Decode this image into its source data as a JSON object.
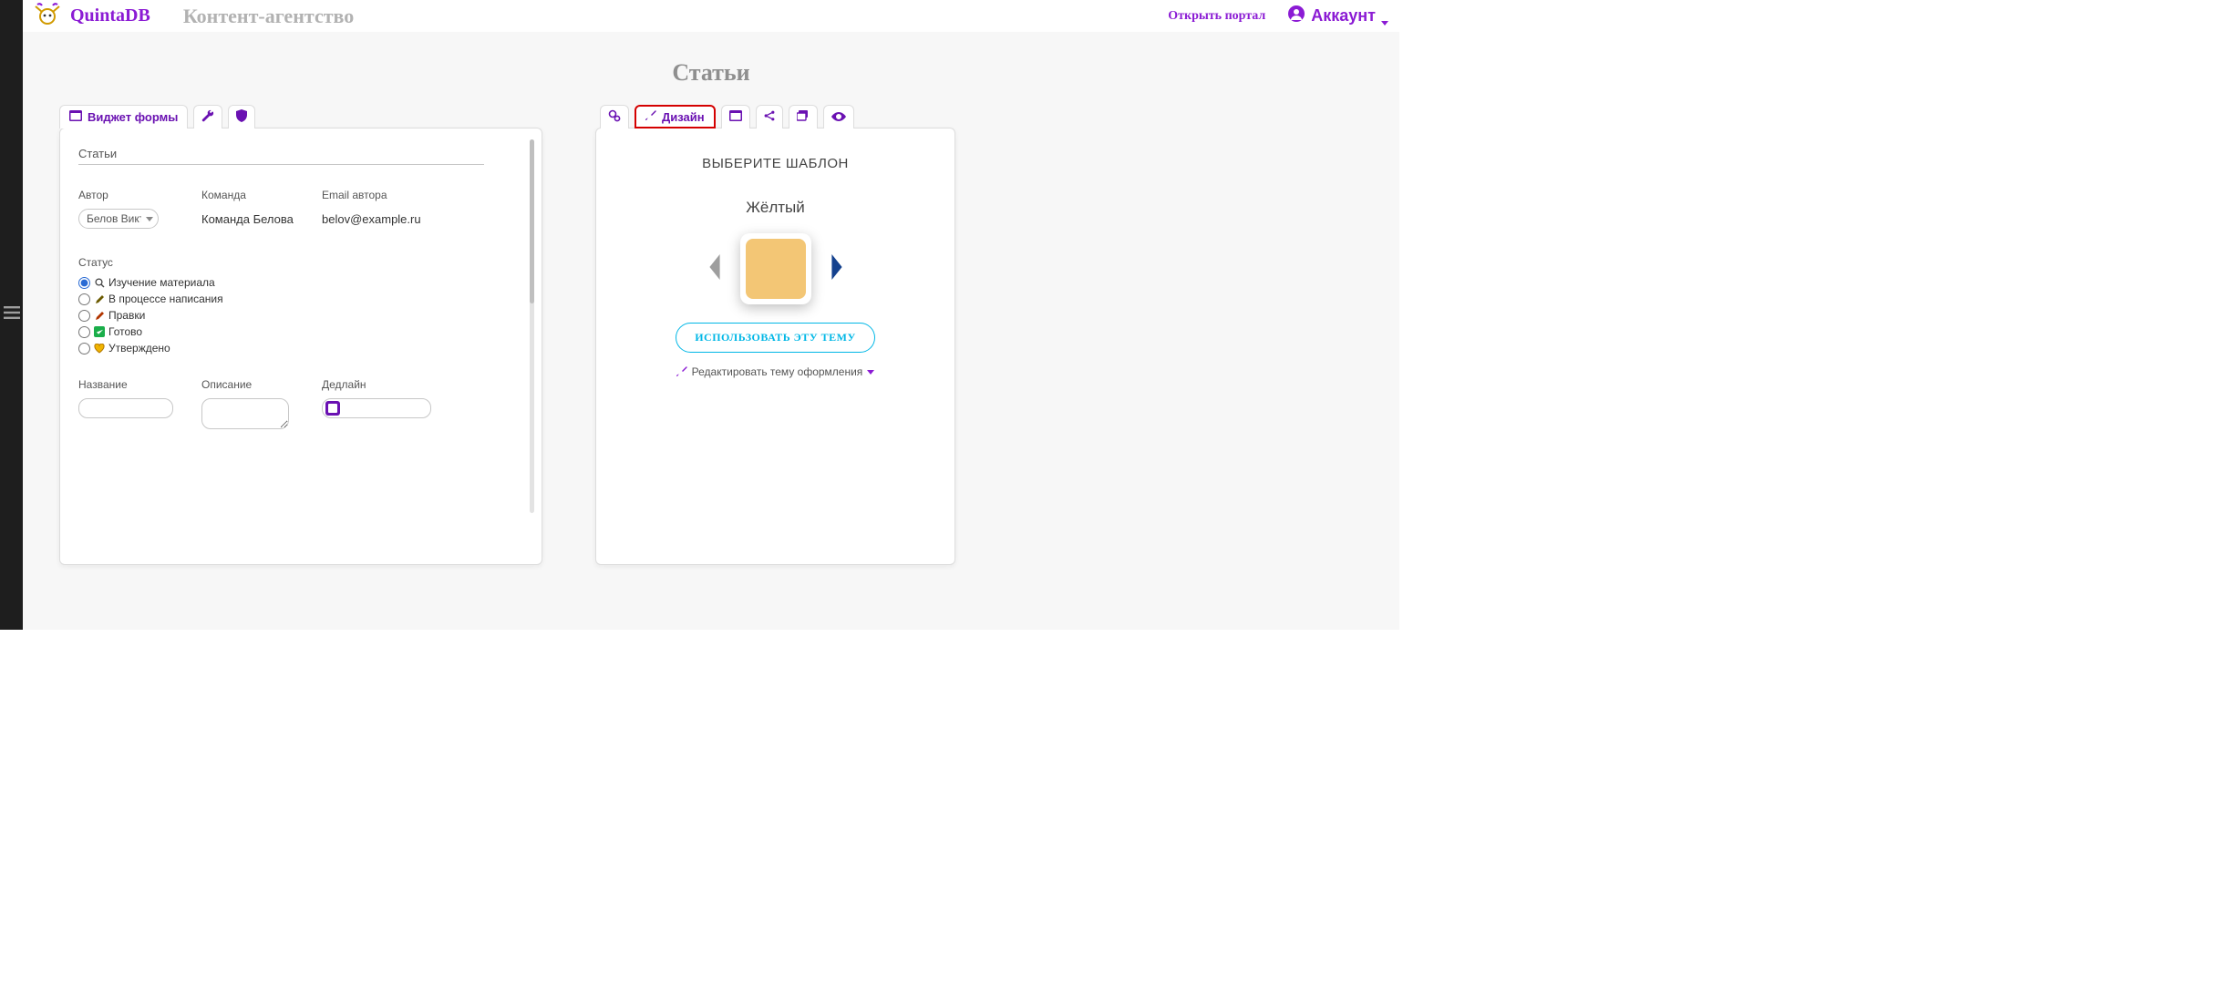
{
  "header": {
    "brand": "QuintaDB",
    "project": "Контент-агентство",
    "portal_link": "Открыть портал",
    "account": "Аккаунт"
  },
  "page": {
    "title": "Статьи"
  },
  "left": {
    "tab_widget": "Виджет формы",
    "form_name": "Статьи",
    "fields": {
      "author_label": "Автор",
      "author_value": "Белов Виктор",
      "team_label": "Команда",
      "team_value": "Команда Белова",
      "email_label": "Email автора",
      "email_value": "belov@example.ru",
      "status_label": "Статус",
      "status_options": [
        {
          "label": "Изучение материала",
          "checked": true,
          "icon": "search"
        },
        {
          "label": "В процессе написания",
          "checked": false,
          "icon": "pencil"
        },
        {
          "label": "Правки",
          "checked": false,
          "icon": "edit"
        },
        {
          "label": "Готово",
          "checked": false,
          "icon": "check"
        },
        {
          "label": "Утверждено",
          "checked": false,
          "icon": "heart"
        }
      ],
      "title_label": "Название",
      "title_value": "",
      "desc_label": "Описание",
      "desc_value": "",
      "deadline_label": "Дедлайн",
      "deadline_value": ""
    }
  },
  "right": {
    "tab_design": "Дизайн",
    "heading": "ВЫБЕРИТЕ ШАБЛОН",
    "theme_name": "Жёлтый",
    "theme_color": "#f3c675",
    "use_button": "ИСПОЛЬЗОВАТЬ ЭТУ ТЕМУ",
    "edit_theme": "Редактировать тему оформления"
  }
}
